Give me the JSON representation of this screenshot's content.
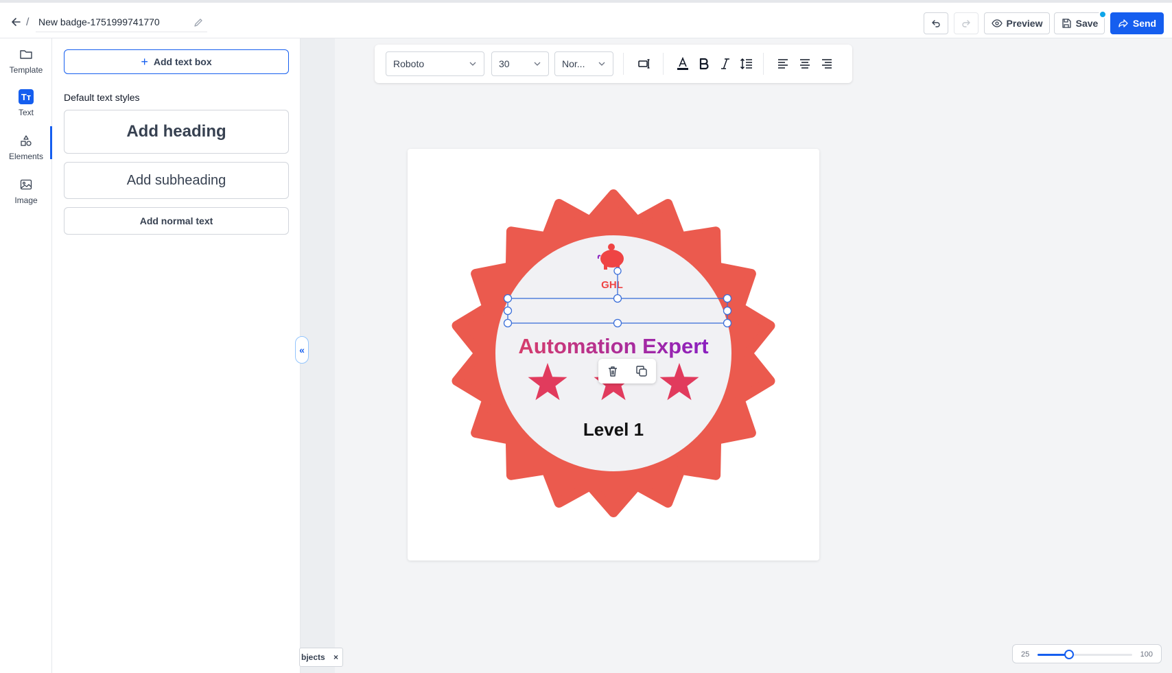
{
  "header": {
    "separator": "/",
    "document_title": "New badge-1751999741770",
    "preview_label": "Preview",
    "save_label": "Save",
    "send_label": "Send"
  },
  "rail": {
    "items": [
      {
        "label": "Template",
        "icon": "folder-icon"
      },
      {
        "label": "Text",
        "icon": "text-tt-icon",
        "icon_text": "Tт",
        "active": true
      },
      {
        "label": "Elements",
        "icon": "shapes-icon"
      },
      {
        "label": "Image",
        "icon": "image-icon"
      }
    ]
  },
  "text_panel": {
    "add_text_box_label": "Add text box",
    "default_styles_label": "Default text styles",
    "heading_label": "Add heading",
    "subheading_label": "Add subheading",
    "normal_text_label": "Add normal text"
  },
  "format_toolbar": {
    "font_family": "Roboto",
    "font_size": "30",
    "font_weight": "Nor..."
  },
  "badge": {
    "logo_text": "GHL",
    "title": "Automation Expert",
    "level_text": "Level 1",
    "outer_color": "#eb5a4e",
    "inner_color": "#f1f1f4",
    "title_gradient": [
      "#d63d6b",
      "#8a1fc0"
    ],
    "star_color": "#e13b5d",
    "star_count": 3
  },
  "objects_tab": {
    "label": "bjects",
    "close": "×"
  },
  "zoom": {
    "min_label": "25",
    "max_label": "100",
    "value_fraction": 0.33
  },
  "colors": {
    "accent": "#155eef",
    "selection": "#3b6fd9"
  }
}
